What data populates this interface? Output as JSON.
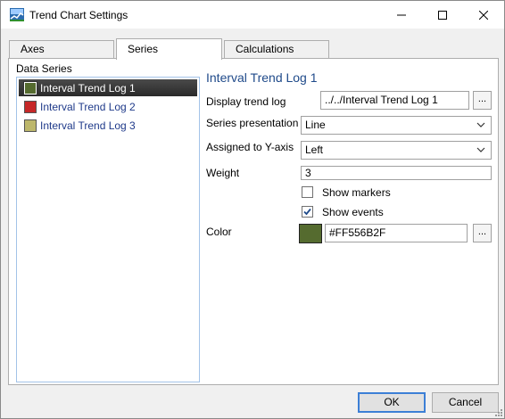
{
  "window": {
    "title": "Trend Chart Settings",
    "app_icon": "trend-chart-icon",
    "controls": {
      "minimize": "minimize-icon",
      "maximize": "maximize-icon",
      "close": "close-icon"
    }
  },
  "tabs": [
    {
      "label": "Axes",
      "active": false
    },
    {
      "label": "Series",
      "active": true
    },
    {
      "label": "Calculations",
      "active": false
    }
  ],
  "data_series": {
    "label": "Data Series",
    "items": [
      {
        "label": "Interval Trend Log 1",
        "color": "#556B2F",
        "selected": true
      },
      {
        "label": "Interval Trend Log 2",
        "color": "#C62828",
        "selected": false
      },
      {
        "label": "Interval Trend Log 3",
        "color": "#BDB76B",
        "selected": false
      }
    ]
  },
  "details": {
    "title": "Interval Trend Log 1",
    "display_trend_log": {
      "label": "Display trend log",
      "value": "../../Interval Trend Log 1",
      "browse": "..."
    },
    "series_presentation": {
      "label": "Series presentation",
      "value": "Line"
    },
    "assigned_axis": {
      "label": "Assigned to Y-axis",
      "value": "Left"
    },
    "weight": {
      "label": "Weight",
      "value": "3"
    },
    "show_markers": {
      "label": "Show markers",
      "checked": false
    },
    "show_events": {
      "label": "Show events",
      "checked": true
    },
    "color": {
      "label": "Color",
      "value": "#FF556B2F",
      "swatch": "#556B2F",
      "browse": "..."
    }
  },
  "buttons": {
    "ok": "OK",
    "cancel": "Cancel"
  }
}
